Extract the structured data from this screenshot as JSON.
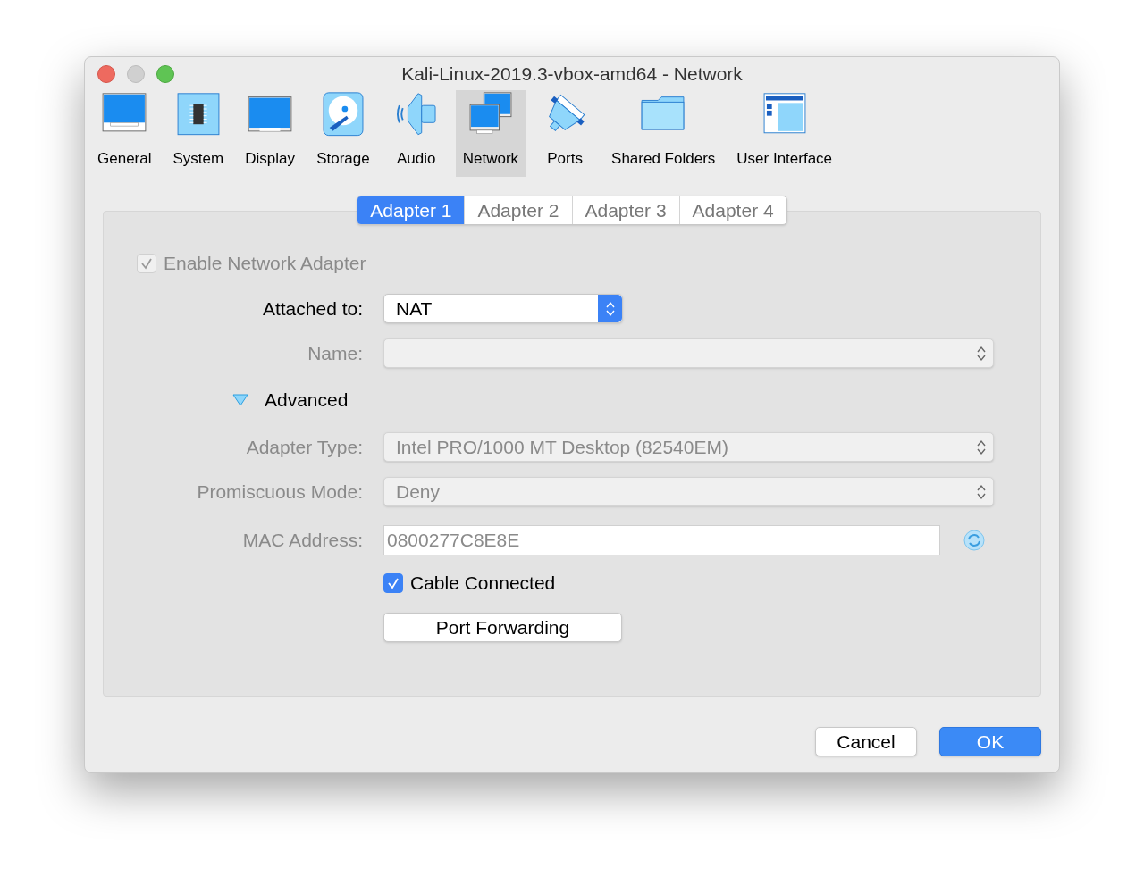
{
  "window": {
    "title": "Kali-Linux-2019.3-vbox-amd64 - Network"
  },
  "toolbar": [
    {
      "label": "General",
      "kind": "general",
      "selected": false
    },
    {
      "label": "System",
      "kind": "system",
      "selected": false
    },
    {
      "label": "Display",
      "kind": "display",
      "selected": false
    },
    {
      "label": "Storage",
      "kind": "storage",
      "selected": false
    },
    {
      "label": "Audio",
      "kind": "audio",
      "selected": false
    },
    {
      "label": "Network",
      "kind": "network",
      "selected": true
    },
    {
      "label": "Ports",
      "kind": "ports",
      "selected": false
    },
    {
      "label": "Shared Folders",
      "kind": "folder",
      "selected": false
    },
    {
      "label": "User Interface",
      "kind": "ui",
      "selected": false
    }
  ],
  "adapter_tabs": [
    {
      "label": "Adapter 1",
      "selected": true
    },
    {
      "label": "Adapter 2",
      "selected": false
    },
    {
      "label": "Adapter 3",
      "selected": false
    },
    {
      "label": "Adapter 4",
      "selected": false
    }
  ],
  "enable_adapter": {
    "label": "Enable Network Adapter",
    "checked": true,
    "disabled": true
  },
  "attached_to": {
    "label": "Attached to:",
    "value": "NAT",
    "disabled": false
  },
  "name": {
    "label": "Name:",
    "disabled": true
  },
  "advanced": {
    "label": "Advanced",
    "expanded": true
  },
  "adapter_type": {
    "label": "Adapter Type:",
    "value": "Intel PRO/1000 MT Desktop (82540EM)",
    "disabled": true
  },
  "promiscuous_mode": {
    "label": "Promiscuous Mode:",
    "value": "Deny",
    "disabled": true
  },
  "mac_address": {
    "label": "MAC Address:",
    "value": "0800277C8E8E",
    "disabled": true
  },
  "cable_connected": {
    "label": "Cable Connected",
    "checked": true
  },
  "port_forwarding": {
    "label": "Port Forwarding"
  },
  "buttons": [
    {
      "label": "Cancel",
      "kind": "cancel"
    },
    {
      "label": "OK",
      "kind": "default"
    }
  ]
}
